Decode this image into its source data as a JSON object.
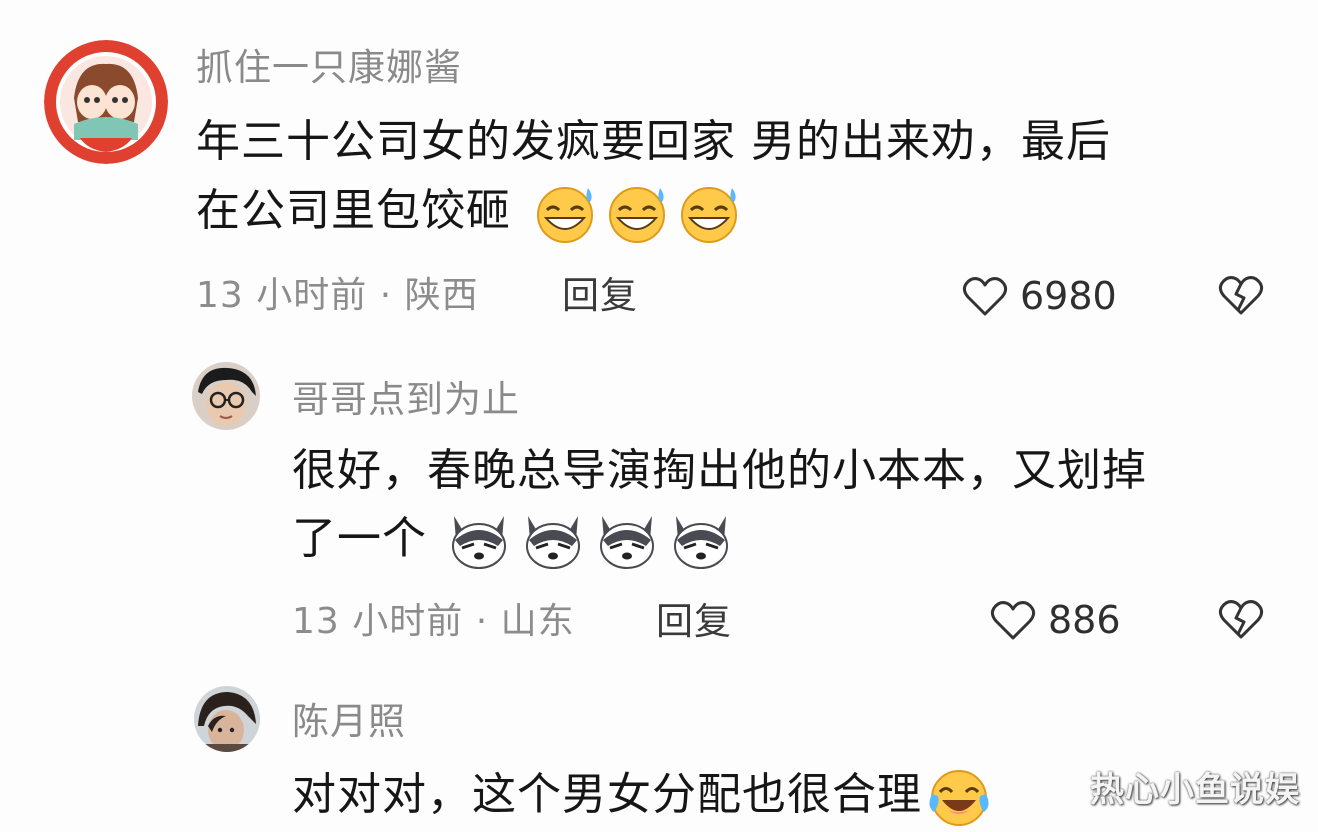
{
  "comments": [
    {
      "username": "抓住一只康娜酱",
      "text_line1": "年三十公司女的发疯要回家 男的出来劝，最后",
      "text_line2": "在公司里包饺砸",
      "emoji": "sweat-grin-emoji",
      "emoji_count": 3,
      "time_location": "13 小时前 · 陕西",
      "reply_label": "回复",
      "likes": "6980",
      "avatar": "anime-couple-avatar"
    },
    {
      "username": "哥哥点到为止",
      "text_line1": "很好，春晚总导演掏出他的小本本，又划掉",
      "text_line2": "了一个",
      "emoji": "husky-dog-emoji",
      "emoji_count": 4,
      "time_location": "13 小时前 · 山东",
      "reply_label": "回复",
      "likes": "886",
      "avatar": "glasses-man-avatar"
    },
    {
      "username": "陈月照",
      "text_line1": "对对对，这个男女分配也很合理",
      "emoji": "tears-of-joy-emoji",
      "emoji_count": 1,
      "avatar": "dark-hair-avatar"
    }
  ],
  "watermark": "热心小鱼说娱",
  "icons": {
    "like": "heart-icon",
    "dislike": "broken-heart-icon"
  }
}
